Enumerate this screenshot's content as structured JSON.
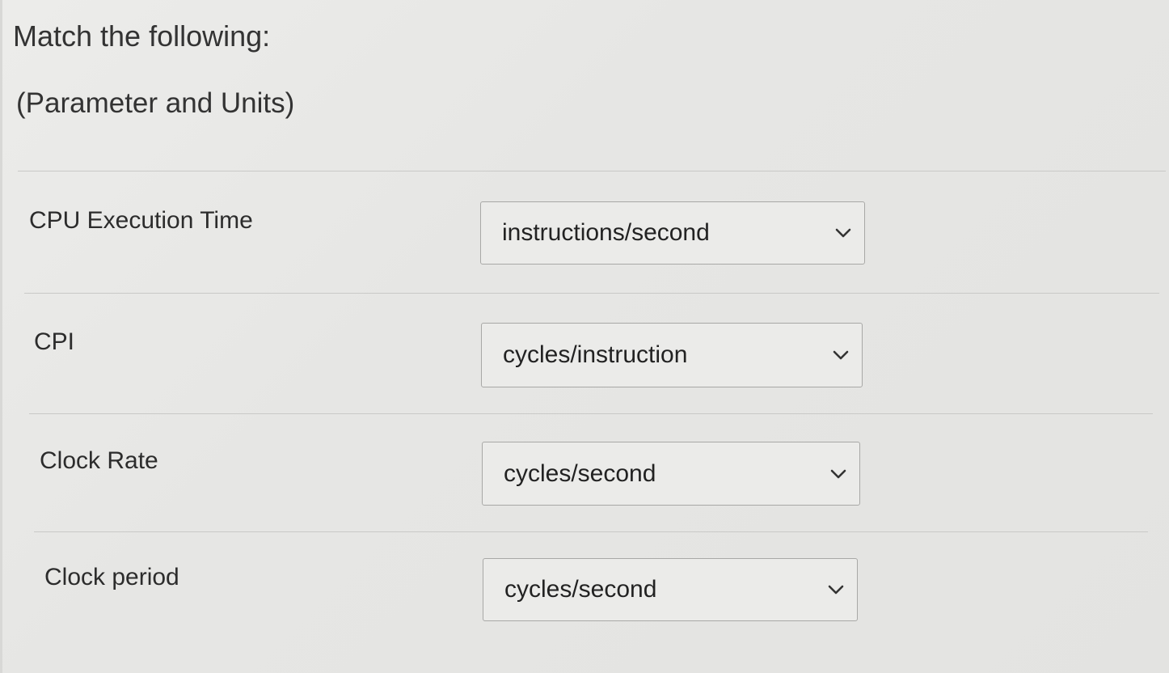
{
  "question": {
    "title": "Match the following:",
    "subtitle": "(Parameter and Units)"
  },
  "rows": [
    {
      "parameter": "CPU Execution Time",
      "selected": "instructions/second"
    },
    {
      "parameter": "CPI",
      "selected": "cycles/instruction"
    },
    {
      "parameter": "Clock Rate",
      "selected": "cycles/second"
    },
    {
      "parameter": "Clock period",
      "selected": "cycles/second"
    }
  ],
  "icons": {
    "dropdown": "chevron-down-icon"
  }
}
